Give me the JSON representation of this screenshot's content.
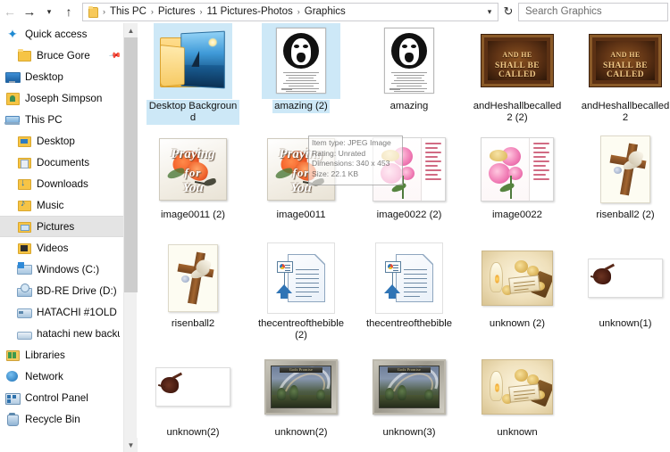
{
  "window": {
    "app": "File Explorer"
  },
  "addressbar": {
    "back_icon": "back-arrow-icon",
    "forward_icon": "forward-arrow-icon",
    "history_icon": "chevron-down-icon",
    "up_icon": "up-arrow-icon",
    "folder_icon": "folder-icon",
    "breadcrumbs": [
      "This PC",
      "Pictures",
      "11 Pictures-Photos",
      "Graphics"
    ],
    "separator": "›",
    "dropdown_icon": "chevron-down-icon",
    "refresh_icon": "refresh-icon",
    "refresh_glyph": "↻",
    "search_placeholder": "Search Graphics"
  },
  "navpane": {
    "items": [
      {
        "label": "Quick access",
        "icon": "star-icon",
        "level": 0,
        "selected": false,
        "pinned": false
      },
      {
        "label": "Bruce Gore",
        "icon": "folder-icon",
        "level": 1,
        "selected": false,
        "pinned": true
      },
      {
        "label": "Desktop",
        "icon": "desktop-monitor-icon",
        "level": 0,
        "selected": false,
        "pinned": false
      },
      {
        "label": "Joseph Simpson",
        "icon": "user-folder-icon",
        "level": 0,
        "selected": false,
        "pinned": false
      },
      {
        "label": "This PC",
        "icon": "this-pc-icon",
        "level": 0,
        "selected": false,
        "pinned": false
      },
      {
        "label": "Desktop",
        "icon": "desktop-folder-icon",
        "level": 1,
        "selected": false,
        "pinned": false
      },
      {
        "label": "Documents",
        "icon": "documents-folder-icon",
        "level": 1,
        "selected": false,
        "pinned": false
      },
      {
        "label": "Downloads",
        "icon": "downloads-folder-icon",
        "level": 1,
        "selected": false,
        "pinned": false
      },
      {
        "label": "Music",
        "icon": "music-folder-icon",
        "level": 1,
        "selected": false,
        "pinned": false
      },
      {
        "label": "Pictures",
        "icon": "pictures-folder-icon",
        "level": 1,
        "selected": true,
        "pinned": false
      },
      {
        "label": "Videos",
        "icon": "videos-folder-icon",
        "level": 1,
        "selected": false,
        "pinned": false
      },
      {
        "label": "Windows (C:)",
        "icon": "windows-drive-icon",
        "level": 1,
        "selected": false,
        "pinned": false
      },
      {
        "label": "BD-RE Drive (D:)",
        "icon": "optical-drive-icon",
        "level": 1,
        "selected": false,
        "pinned": false
      },
      {
        "label": "HATACHI #1OLD (",
        "icon": "hard-drive-icon",
        "level": 1,
        "selected": false,
        "pinned": false
      },
      {
        "label": "hatachi new backu",
        "icon": "hard-drive-icon",
        "level": 1,
        "selected": false,
        "pinned": false
      },
      {
        "label": "Libraries",
        "icon": "libraries-icon",
        "level": 0,
        "selected": false,
        "pinned": false
      },
      {
        "label": "Network",
        "icon": "network-icon",
        "level": 0,
        "selected": false,
        "pinned": false
      },
      {
        "label": "Control Panel",
        "icon": "control-panel-icon",
        "level": 0,
        "selected": false,
        "pinned": false
      },
      {
        "label": "Recycle Bin",
        "icon": "recycle-bin-icon",
        "level": 0,
        "selected": false,
        "pinned": false
      }
    ],
    "scrollbar": {
      "up_glyph": "∧",
      "down_glyph": "∨"
    }
  },
  "content": {
    "tiles": [
      {
        "label": "Desktop Background",
        "kind": "folder",
        "selected": true
      },
      {
        "label": "amazing (2)",
        "kind": "paper",
        "selected": true
      },
      {
        "label": "amazing",
        "kind": "paper",
        "selected": false
      },
      {
        "label": "andHeshallbecalled2 (2)",
        "kind": "sepia",
        "selected": false
      },
      {
        "label": "andHeshallbecalled2",
        "kind": "sepia",
        "selected": false
      },
      {
        "label": "image0011 (2)",
        "kind": "praying",
        "selected": false
      },
      {
        "label": "image0011",
        "kind": "praying",
        "selected": false
      },
      {
        "label": "image0022 (2)",
        "kind": "pinkcard",
        "selected": false
      },
      {
        "label": "image0022",
        "kind": "pinkcard",
        "selected": false
      },
      {
        "label": "risenball2 (2)",
        "kind": "cross",
        "selected": false
      },
      {
        "label": "risenball2",
        "kind": "cross",
        "selected": false
      },
      {
        "label": "thecentreofthebible (2)",
        "kind": "doc",
        "selected": false
      },
      {
        "label": "thecentreofthebible",
        "kind": "doc",
        "selected": false
      },
      {
        "label": "unknown (2)",
        "kind": "golden",
        "selected": false
      },
      {
        "label": "unknown(1)",
        "kind": "thorn",
        "selected": false
      },
      {
        "label": "unknown(2)",
        "kind": "thorn",
        "selected": false
      },
      {
        "label": "unknown(2)",
        "kind": "rainbow",
        "selected": false
      },
      {
        "label": "unknown(3)",
        "kind": "rainbow",
        "selected": false
      },
      {
        "label": "unknown",
        "kind": "golden",
        "selected": false
      }
    ],
    "sepia_text": {
      "line1": "AND HE",
      "line2": "SHALL BE CALLED"
    },
    "praying_text": {
      "line1": "Praying",
      "line2": "for",
      "line3": "You"
    },
    "rainbow_caption": "Gods Promise"
  },
  "tooltip": {
    "lines": [
      "Item type: JPEG Image",
      "Rating: Unrated",
      "Dimensions: 340 x 453",
      "Size: 22.1 KB"
    ]
  },
  "colors": {
    "selection": "#cde8f7",
    "nav_selection": "#e4e4e4",
    "folder_yellow": "#f6c445",
    "accent_blue": "#2f74b5"
  }
}
